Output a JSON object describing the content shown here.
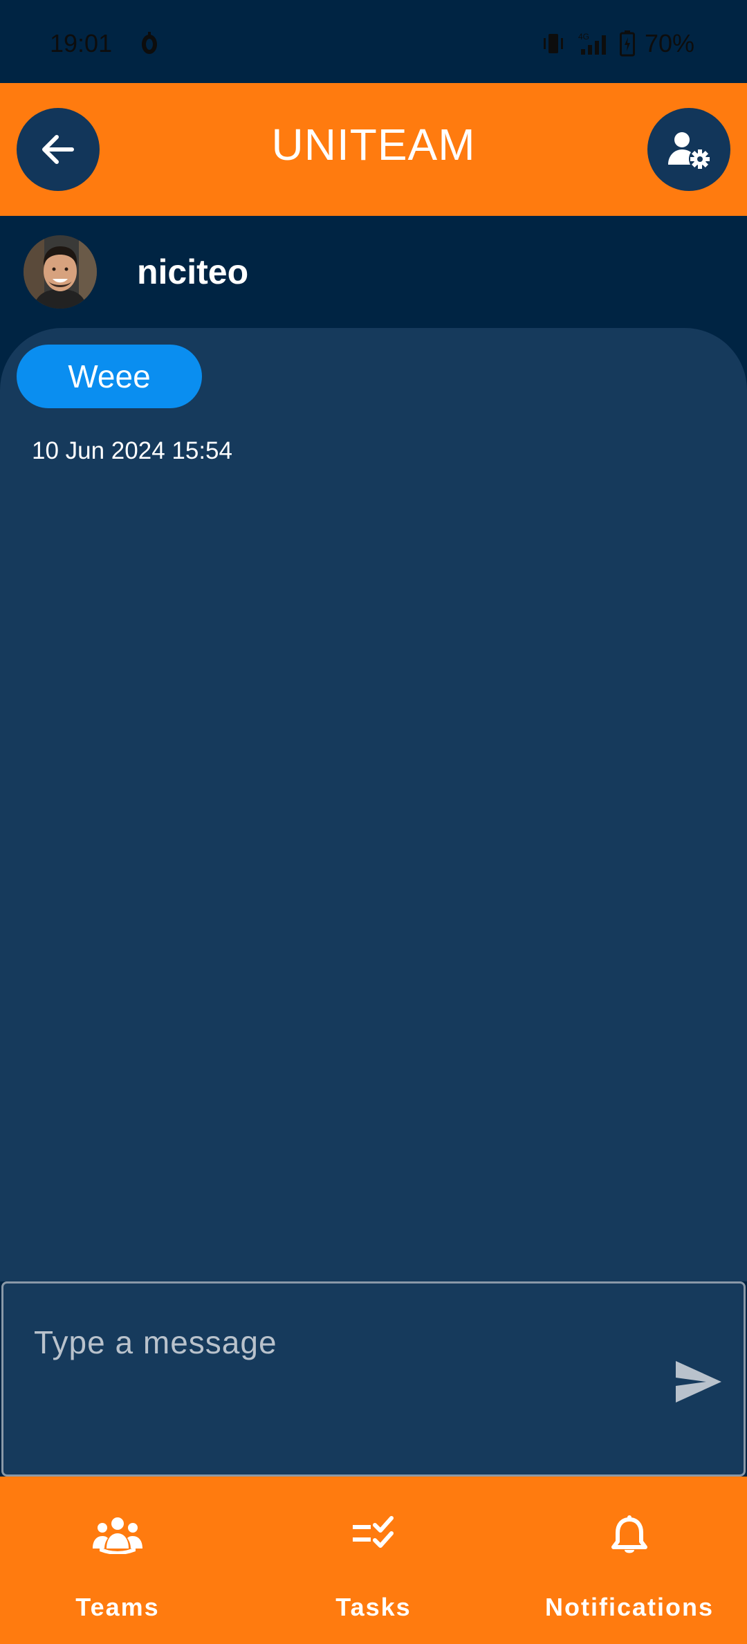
{
  "status_bar": {
    "time": "19:01",
    "battery": "70%",
    "network": "4G"
  },
  "app_bar": {
    "title": "UNITEAM",
    "back_icon": "arrow-left-icon",
    "settings_icon": "user-gear-icon"
  },
  "chat_header": {
    "username": "niciteo"
  },
  "messages": [
    {
      "text": "Weee",
      "timestamp": "10 Jun 2024 15:54"
    }
  ],
  "composer": {
    "placeholder": "Type a message",
    "value": "",
    "send_icon": "send-icon"
  },
  "bottom_nav": {
    "items": [
      {
        "label": "Teams",
        "icon": "people-group-icon"
      },
      {
        "label": "Tasks",
        "icon": "checklist-icon"
      },
      {
        "label": "Notifications",
        "icon": "bell-icon"
      }
    ]
  },
  "colors": {
    "background": "#002443",
    "accent": "#ff7b0f",
    "chat_panel": "#163a5c",
    "bubble": "#0a8ef0",
    "button_circle": "#12365a"
  }
}
